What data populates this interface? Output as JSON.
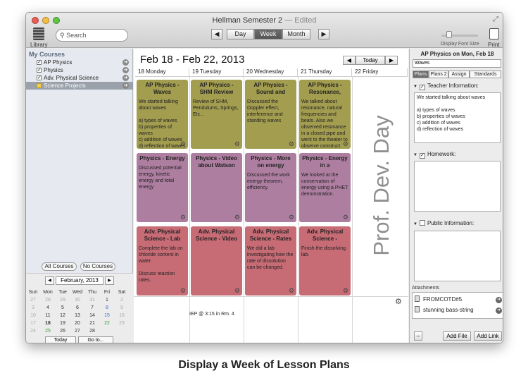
{
  "window": {
    "title": "Hellman Semester 2",
    "title_suffix": "— Edited"
  },
  "toolbar": {
    "library_label": "Library",
    "search_placeholder": "Search",
    "prev": "◀",
    "next": "▶",
    "views": [
      "Day",
      "Week",
      "Month"
    ],
    "active_view": "Week",
    "font_size_label": "Display Font Size",
    "print_label": "Print"
  },
  "sidebar": {
    "heading": "My Courses",
    "courses": [
      {
        "name": "AP Physics",
        "checked": true
      },
      {
        "name": "Physics",
        "checked": true
      },
      {
        "name": "Adv. Physical Science",
        "checked": true
      },
      {
        "name": "Science Projects",
        "checked": false,
        "selected": true
      }
    ],
    "all_courses": "All Courses",
    "no_courses": "No Courses",
    "mini_calendar": {
      "month": "February, 2013",
      "prev": "◀",
      "next": "▶",
      "dow": [
        "Sun",
        "Mon",
        "Tue",
        "Wed",
        "Thu",
        "Fri",
        "Sat"
      ],
      "weeks": [
        [
          "27",
          "28",
          "29",
          "30",
          "31",
          "1",
          "2"
        ],
        [
          "3",
          "4",
          "5",
          "6",
          "7",
          "8",
          "9"
        ],
        [
          "10",
          "11",
          "12",
          "13",
          "14",
          "15",
          "16"
        ],
        [
          "17",
          "18",
          "19",
          "20",
          "21",
          "22",
          "23"
        ],
        [
          "24",
          "25",
          "26",
          "27",
          "28",
          "",
          ""
        ]
      ],
      "today_btn": "Today",
      "goto_btn": "Go to..."
    }
  },
  "main": {
    "date_range": "Feb 18 - Feb 22, 2013",
    "today_label": "Today",
    "prev": "◀",
    "next": "▶",
    "days": [
      "18 Monday",
      "19 Tuesday",
      "20 Wednesday",
      "21 Thursday",
      "22 Friday"
    ],
    "rows": [
      {
        "color": "#a39d50",
        "cards": [
          {
            "title": "AP Physics - Waves",
            "body": "We started talking about waves\n\na) types of waves\nb) properties of waves\nc) addition of waves\nd) reflection of waves"
          },
          {
            "title": "AP Physics - SHM Review",
            "body": "Review of SHM, Pendulums, Springs, Etc..."
          },
          {
            "title": "AP Physics - Sound and",
            "body": "Discussed the Doppler effect, interference and standing waves"
          },
          {
            "title": "AP Physics - Resonance,",
            "body": "We talked about resonance, natural frequencies and beats. Also we observed resonance in a closed pipe and went to the theater to observe construct"
          }
        ]
      },
      {
        "color": "#ae7ea1",
        "cards": [
          {
            "title": "Physics - Energy",
            "body": "Discussed potential energy, kinetic energy and total energy"
          },
          {
            "title": "Physics - Video about Watson",
            "body": ""
          },
          {
            "title": "Physics - More on energy",
            "body": "Discussed the work energy theorem, efficiency."
          },
          {
            "title": "Physics - Energy in a",
            "body": "We looked at the conservation of energy using a PHET demonstration."
          }
        ]
      },
      {
        "color": "#c76b75",
        "cards": [
          {
            "title": "Adv. Physical Science - Lab",
            "body": "Complete the lab on chloride content in water.\n\nDiscuss reaction rates."
          },
          {
            "title": "Adv. Physical Science - Video",
            "body": ""
          },
          {
            "title": "Adv. Physical Science - Rates",
            "body": "We did a lab investigating how the rate of dissolution can be changed."
          },
          {
            "title": "Adv. Physical Science -",
            "body": "Finish the dissolving lab."
          }
        ]
      }
    ],
    "friday_note": "Prof. Dev. Day",
    "tuesday_note": "IEP @ 3:15 in Rm. 4"
  },
  "detail": {
    "title": "AP Physics on Mon, Feb 18",
    "field_value": "Waves",
    "tabs": [
      "Plans",
      "Plans 2",
      "Assign",
      "Standards"
    ],
    "active_tab": "Plans",
    "teacher_label": "Teacher Information:",
    "teacher_text": "We started talking about waves\n\na) types of waves\nb) properties of waves\nc) addition of waves\nd) reflection of waves",
    "homework_label": "Homework:",
    "public_label": "Public Information:",
    "attachments_label": "Attachments",
    "attachments": [
      "FROMCOTD#5",
      "stunning bass-string"
    ],
    "remove_btn": "–",
    "add_file_btn": "Add File",
    "add_link_btn": "Add Link"
  },
  "caption": "Display a Week of Lesson Plans"
}
